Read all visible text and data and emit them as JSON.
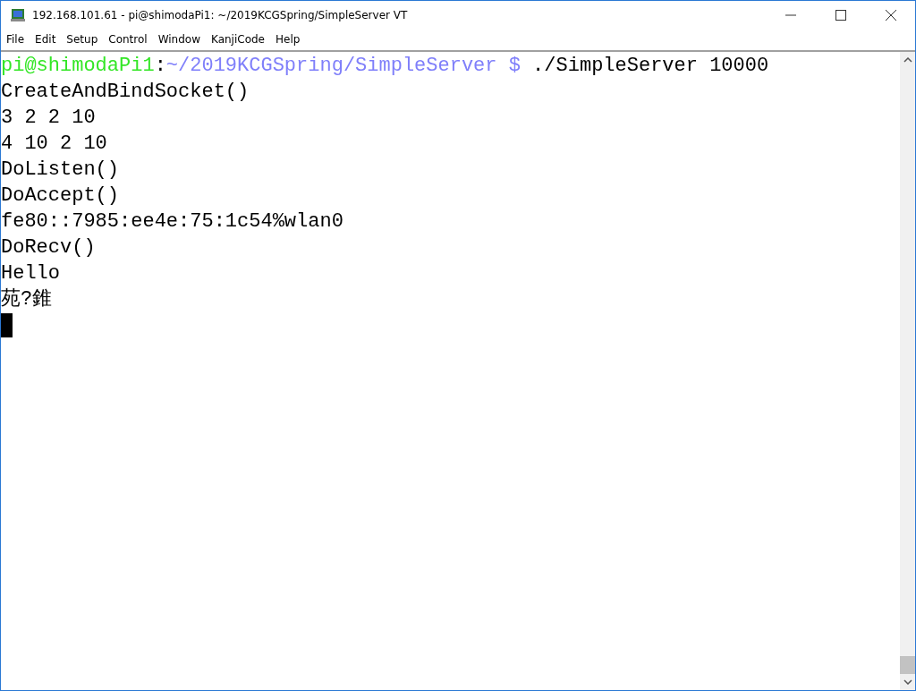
{
  "window": {
    "title": "192.168.101.61 - pi@shimodaPi1: ~/2019KCGSpring/SimpleServer VT"
  },
  "menu": [
    "File",
    "Edit",
    "Setup",
    "Control",
    "Window",
    "KanjiCode",
    "Help"
  ],
  "terminal": {
    "lines": [
      {
        "kind": "prompt",
        "segments": [
          {
            "text": "pi@shimodaPi1",
            "color": "#33e626"
          },
          {
            "text": ":",
            "color": "#000000"
          },
          {
            "text": "~/2019KCGSpring/SimpleServer $",
            "color": "#7f7ffa"
          },
          {
            "text": " ./SimpleServer 10000",
            "color": "#000000"
          }
        ]
      },
      {
        "kind": "output",
        "text": "CreateAndBindSocket()"
      },
      {
        "kind": "output",
        "text": "3 2 2 10"
      },
      {
        "kind": "output",
        "text": "4 10 2 10"
      },
      {
        "kind": "output",
        "text": "DoListen()"
      },
      {
        "kind": "output",
        "text": "DoAccept()"
      },
      {
        "kind": "output",
        "text": "fe80::7985:ee4e:75:1c54%wlan0"
      },
      {
        "kind": "output",
        "text": "DoRecv()"
      },
      {
        "kind": "output",
        "text": "Hello"
      },
      {
        "kind": "output",
        "text": "苑?錐"
      }
    ]
  }
}
